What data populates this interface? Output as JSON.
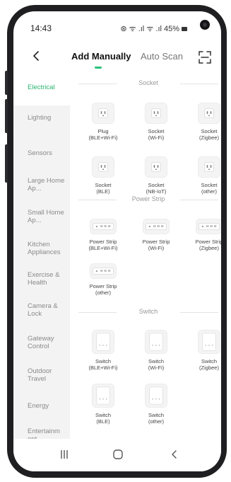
{
  "status": {
    "time": "14:43",
    "indicators": "⊛ ᯤ .ıl ᯤ .ıl",
    "battery": "45%"
  },
  "header": {
    "back_icon": "chevron-left-icon",
    "tabs": [
      {
        "label": "Add Manually",
        "active": true
      },
      {
        "label": "Auto Scan",
        "active": false
      }
    ],
    "scan_icon": "scan-frame-icon"
  },
  "sidebar": {
    "items": [
      {
        "label": "Electrical",
        "active": true
      },
      {
        "label": "Lighting"
      },
      {
        "label": "Sensors"
      },
      {
        "label": "Large Home Ap..."
      },
      {
        "label": "Small Home Ap..."
      },
      {
        "label": "Kitchen Appliances"
      },
      {
        "label": "Exercise & Health"
      },
      {
        "label": "Camera & Lock"
      },
      {
        "label": "Gateway Control"
      },
      {
        "label": "Outdoor Travel"
      },
      {
        "label": "Energy"
      },
      {
        "label": "Entertainm ent"
      }
    ]
  },
  "sections": [
    {
      "title": "Socket",
      "devices": [
        {
          "line1": "Plug",
          "line2": "(BLE+Wi-Fi)",
          "icon": "socket-icon"
        },
        {
          "line1": "Socket",
          "line2": "(Wi-Fi)",
          "icon": "socket-icon"
        },
        {
          "line1": "Socket",
          "line2": "(Zigbee)",
          "icon": "socket-icon"
        },
        {
          "line1": "Socket",
          "line2": "(BLE)",
          "icon": "socket-icon"
        },
        {
          "line1": "Socket",
          "line2": "(NB-IoT)",
          "icon": "socket-icon"
        },
        {
          "line1": "Socket",
          "line2": "(other)",
          "icon": "socket-icon"
        }
      ]
    },
    {
      "title": "Power Strip",
      "devices": [
        {
          "line1": "Power Strip",
          "line2": "(BLE+Wi-Fi)",
          "icon": "power-strip-icon"
        },
        {
          "line1": "Power Strip",
          "line2": "(Wi-Fi)",
          "icon": "power-strip-icon"
        },
        {
          "line1": "Power Strip",
          "line2": "(Zigbee)",
          "icon": "power-strip-icon"
        },
        {
          "line1": "Power Strip",
          "line2": "(other)",
          "icon": "power-strip-icon"
        }
      ]
    },
    {
      "title": "Switch",
      "devices": [
        {
          "line1": "Switch",
          "line2": "(BLE+Wi-Fi)",
          "icon": "wall-switch-icon"
        },
        {
          "line1": "Switch",
          "line2": "(Wi-Fi)",
          "icon": "wall-switch-icon"
        },
        {
          "line1": "Switch",
          "line2": "(Zigbee)",
          "icon": "wall-switch-icon"
        },
        {
          "line1": "Switch",
          "line2": "(BLE)",
          "icon": "wall-switch-icon"
        },
        {
          "line1": "Switch",
          "line2": "(other)",
          "icon": "wall-switch-icon"
        }
      ]
    }
  ],
  "navbar": {
    "recent_icon": "recent-apps-icon",
    "home_icon": "home-icon",
    "back_icon": "back-icon"
  },
  "colors": {
    "accent": "#29c37a",
    "sidebar_bg": "#f3f3f3",
    "frame": "#1f1f21"
  }
}
